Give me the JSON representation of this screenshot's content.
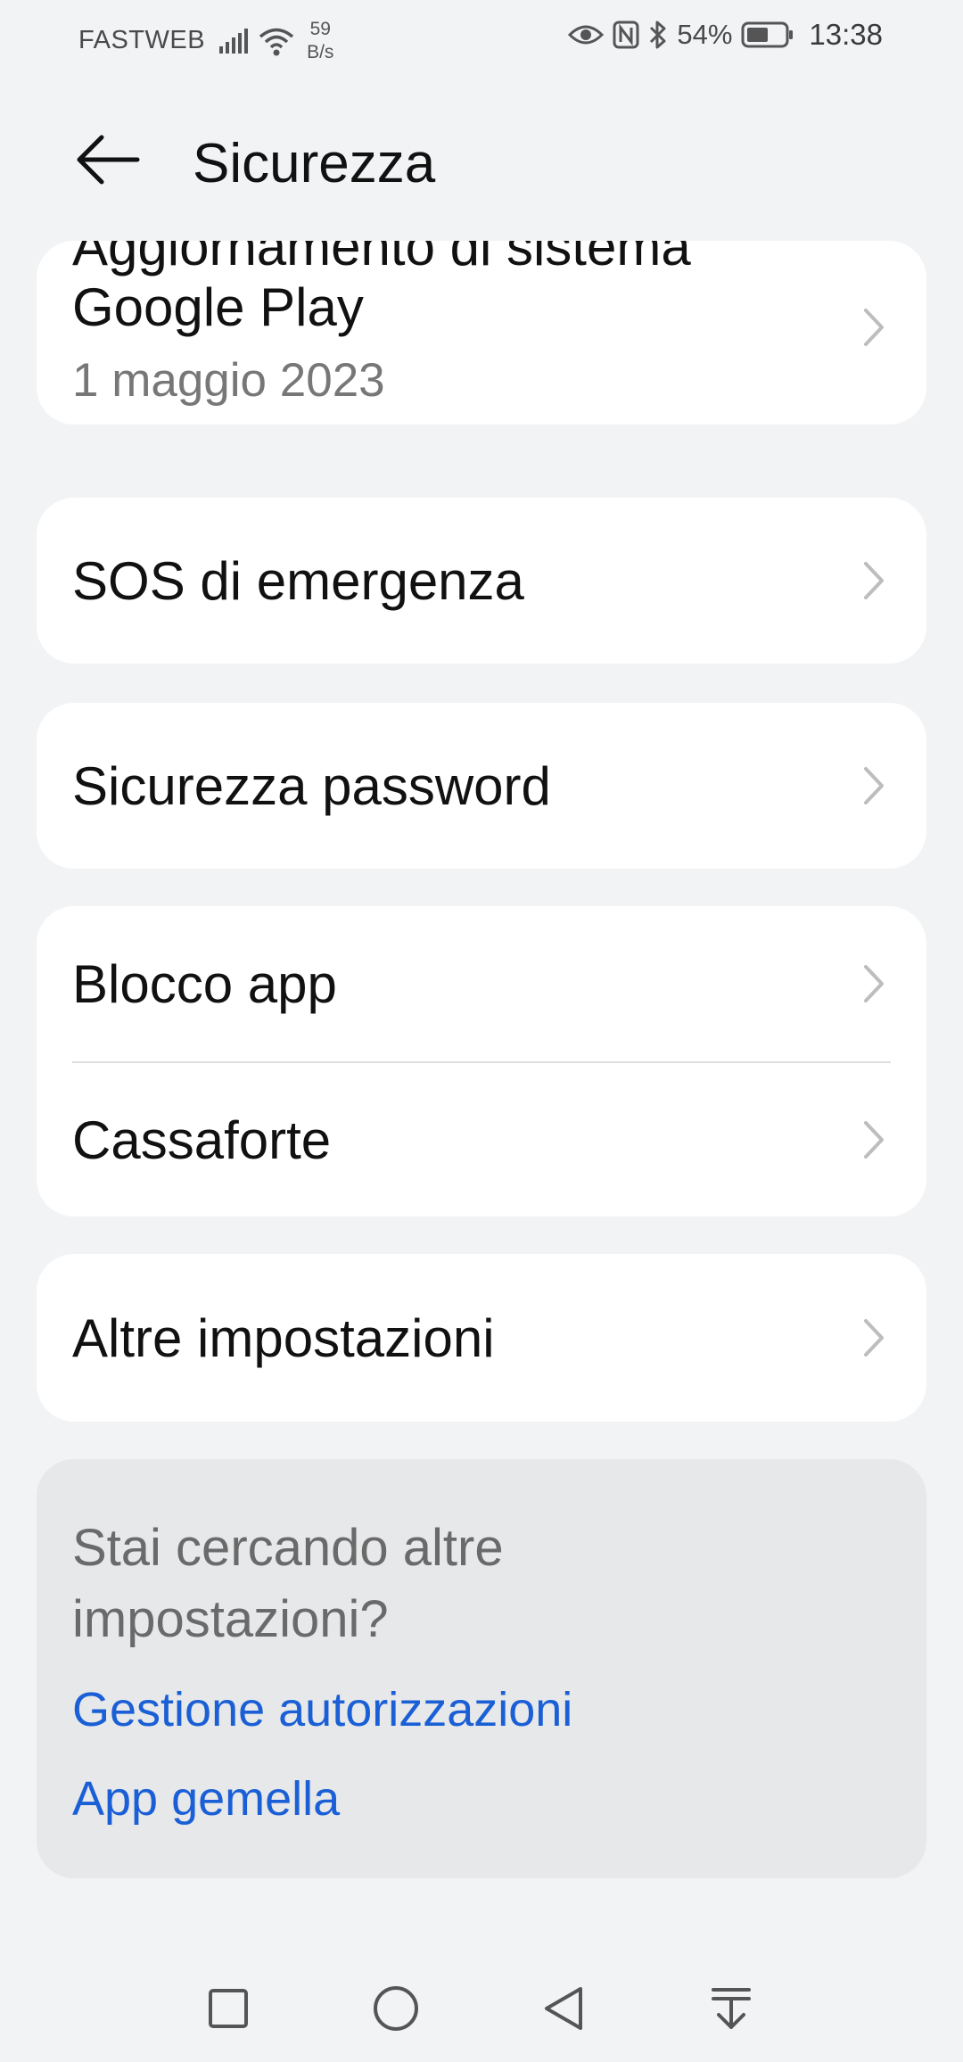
{
  "status_bar": {
    "carrier": "FASTWEB",
    "net_speed_value": "59",
    "net_speed_unit": "B/s",
    "battery_percent": "54%",
    "time": "13:38",
    "icons": [
      "signal-icon",
      "wifi-icon",
      "eye-icon",
      "nfc-icon",
      "bluetooth-icon",
      "battery-icon"
    ]
  },
  "app_bar": {
    "title": "Sicurezza",
    "back_icon": "arrow-left-icon"
  },
  "google_play_update": {
    "title_line1": "Aggiornamento di sistema",
    "title_line2": "Google Play",
    "date": "1 maggio 2023"
  },
  "items": {
    "sos": "SOS di emergenza",
    "password_security": "Sicurezza password",
    "app_lock": "Blocco app",
    "safe": "Cassaforte",
    "more_settings": "Altre impostazioni"
  },
  "suggestions": {
    "title": "Stai cercando altre impostazioni?",
    "links": [
      "Gestione autorizzazioni",
      "App gemella"
    ]
  },
  "colors": {
    "background": "#f1f3f5",
    "card": "#ffffff",
    "suggestion_card": "#e7e8ea",
    "link": "#1a5fd6"
  },
  "nav_bar": {
    "icons": [
      "recents-square-icon",
      "home-circle-icon",
      "back-triangle-icon",
      "notification-pulldown-icon"
    ]
  }
}
